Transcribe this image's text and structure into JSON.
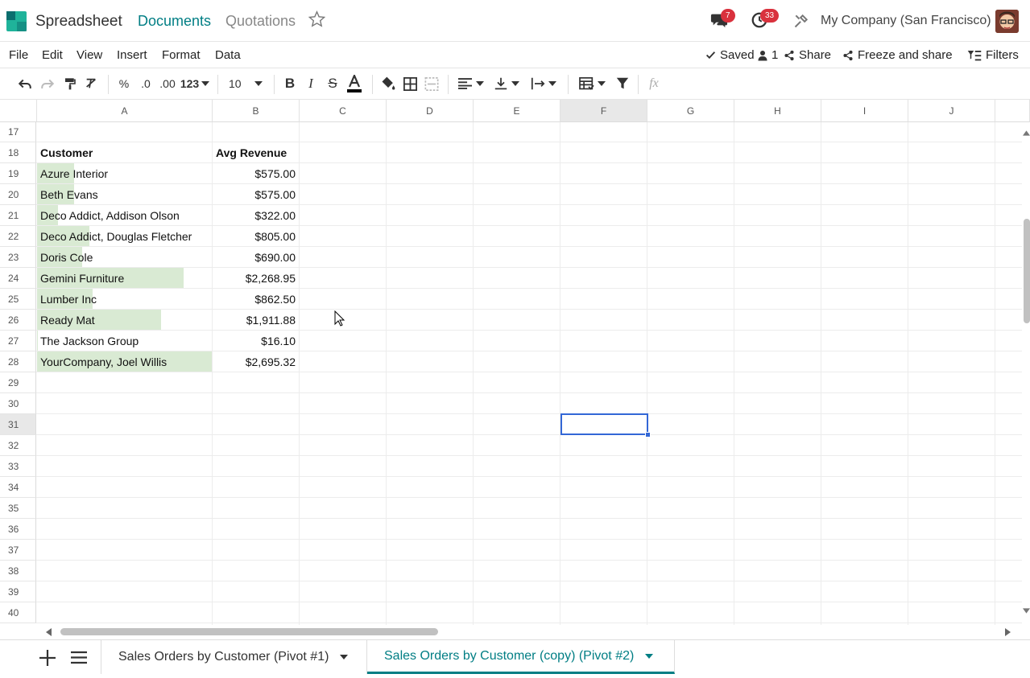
{
  "app": {
    "name": "Spreadsheet",
    "breadcrumb_docs": "Documents",
    "breadcrumb_current": "Quotations"
  },
  "systray": {
    "messages_count": "7",
    "activities_count": "33",
    "company": "My Company (San Francisco)"
  },
  "menu": {
    "file": "File",
    "edit": "Edit",
    "view": "View",
    "insert": "Insert",
    "format": "Format",
    "data": "Data"
  },
  "actions": {
    "saved": "Saved",
    "users_count": "1",
    "share": "Share",
    "freeze_share": "Freeze and share",
    "filters": "Filters"
  },
  "toolbar": {
    "percent": "%",
    "dec_less": ".0",
    "dec_more": ".00",
    "format_num": "123",
    "font_size": "10",
    "fx": "fx"
  },
  "columns": [
    "A",
    "B",
    "C",
    "D",
    "E",
    "F",
    "G",
    "H",
    "I",
    "J"
  ],
  "rows": [
    "17",
    "18",
    "19",
    "20",
    "21",
    "22",
    "23",
    "24",
    "25",
    "26",
    "27",
    "28",
    "29",
    "30",
    "31",
    "32",
    "33",
    "34",
    "35",
    "36",
    "37",
    "38",
    "39",
    "40"
  ],
  "table": {
    "header_customer": "Customer",
    "header_revenue": "Avg Revenue",
    "entries": [
      {
        "customer": "Azure Interior",
        "revenue": "$575.00",
        "bar": 0.21
      },
      {
        "customer": "Beth Evans",
        "revenue": "$575.00",
        "bar": 0.21
      },
      {
        "customer": "Deco Addict, Addison Olson",
        "revenue": "$322.00",
        "bar": 0.12
      },
      {
        "customer": "Deco Addict, Douglas Fletcher",
        "revenue": "$805.00",
        "bar": 0.3
      },
      {
        "customer": "Doris Cole",
        "revenue": "$690.00",
        "bar": 0.26
      },
      {
        "customer": "Gemini Furniture",
        "revenue": "$2,268.95",
        "bar": 0.84
      },
      {
        "customer": "Lumber Inc",
        "revenue": "$862.50",
        "bar": 0.32
      },
      {
        "customer": "Ready Mat",
        "revenue": "$1,911.88",
        "bar": 0.71
      },
      {
        "customer": "The Jackson Group",
        "revenue": "$16.10",
        "bar": 0.006
      },
      {
        "customer": "YourCompany, Joel Willis",
        "revenue": "$2,695.32",
        "bar": 1.0
      }
    ]
  },
  "sheets": [
    {
      "label": "Sales Orders by Customer (Pivot #1)",
      "active": false
    },
    {
      "label": "Sales Orders by Customer (copy) (Pivot #2)",
      "active": true
    }
  ],
  "colors": {
    "accent": "#017e84",
    "databar": "#d9ead3",
    "selection": "#3367d6",
    "badge": "#d9313d"
  }
}
